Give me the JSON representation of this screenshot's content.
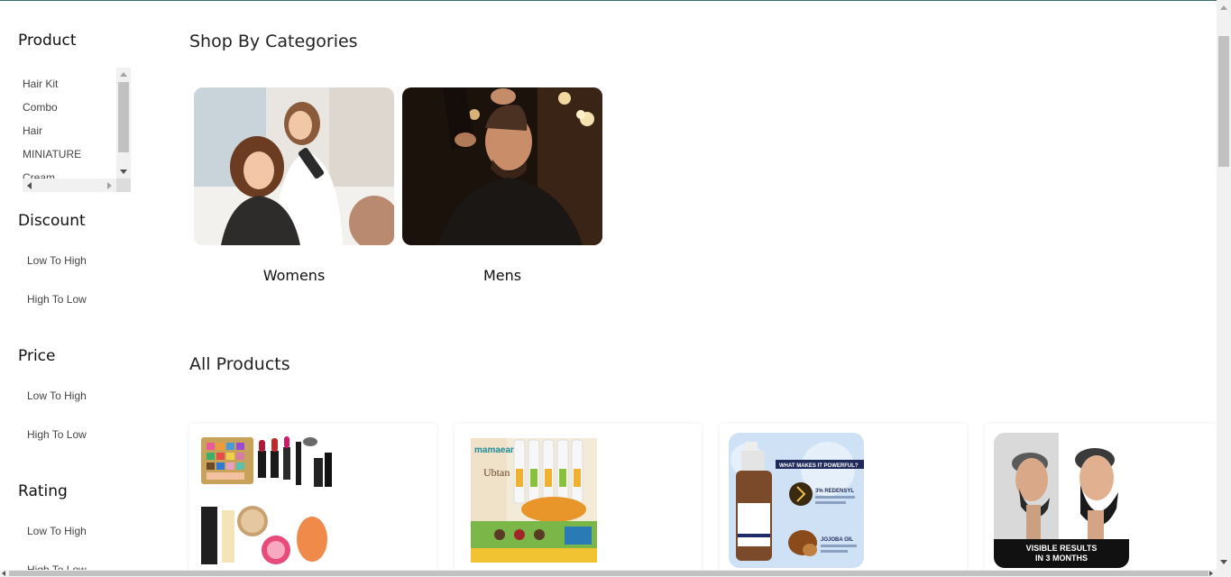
{
  "sidebar": {
    "product": {
      "title": "Product",
      "items": [
        {
          "label": "Hair Kit"
        },
        {
          "label": "Combo"
        },
        {
          "label": "Hair"
        },
        {
          "label": "MINIATURE"
        },
        {
          "label": "Cream"
        }
      ]
    },
    "discount": {
      "title": "Discount",
      "options": [
        "Low To High",
        "High To Low"
      ]
    },
    "price": {
      "title": "Price",
      "options": [
        "Low To High",
        "High To Low"
      ]
    },
    "rating": {
      "title": "Rating",
      "options": [
        "Low To High",
        "High To Low"
      ]
    }
  },
  "main": {
    "categories_title": "Shop By Categories",
    "categories": [
      {
        "label": "Womens"
      },
      {
        "label": "Mens"
      }
    ],
    "products_title": "All Products",
    "products": [
      {
        "image": "makeup-kit"
      },
      {
        "image": "mamaearth-ubtan-facial-kit",
        "brand_text": "mamaearth",
        "product_text": "Ubtan"
      },
      {
        "image": "hair-serum",
        "headline_text": "WHAT MAKES IT POWERFUL?",
        "ingredient_1": "3% REDENSYL",
        "ingredient_2": "JOJOBA OIL"
      },
      {
        "image": "beard-growth",
        "caption_line_1": "VISIBLE RESULTS",
        "caption_line_2": "IN 3 MONTHS"
      }
    ]
  }
}
